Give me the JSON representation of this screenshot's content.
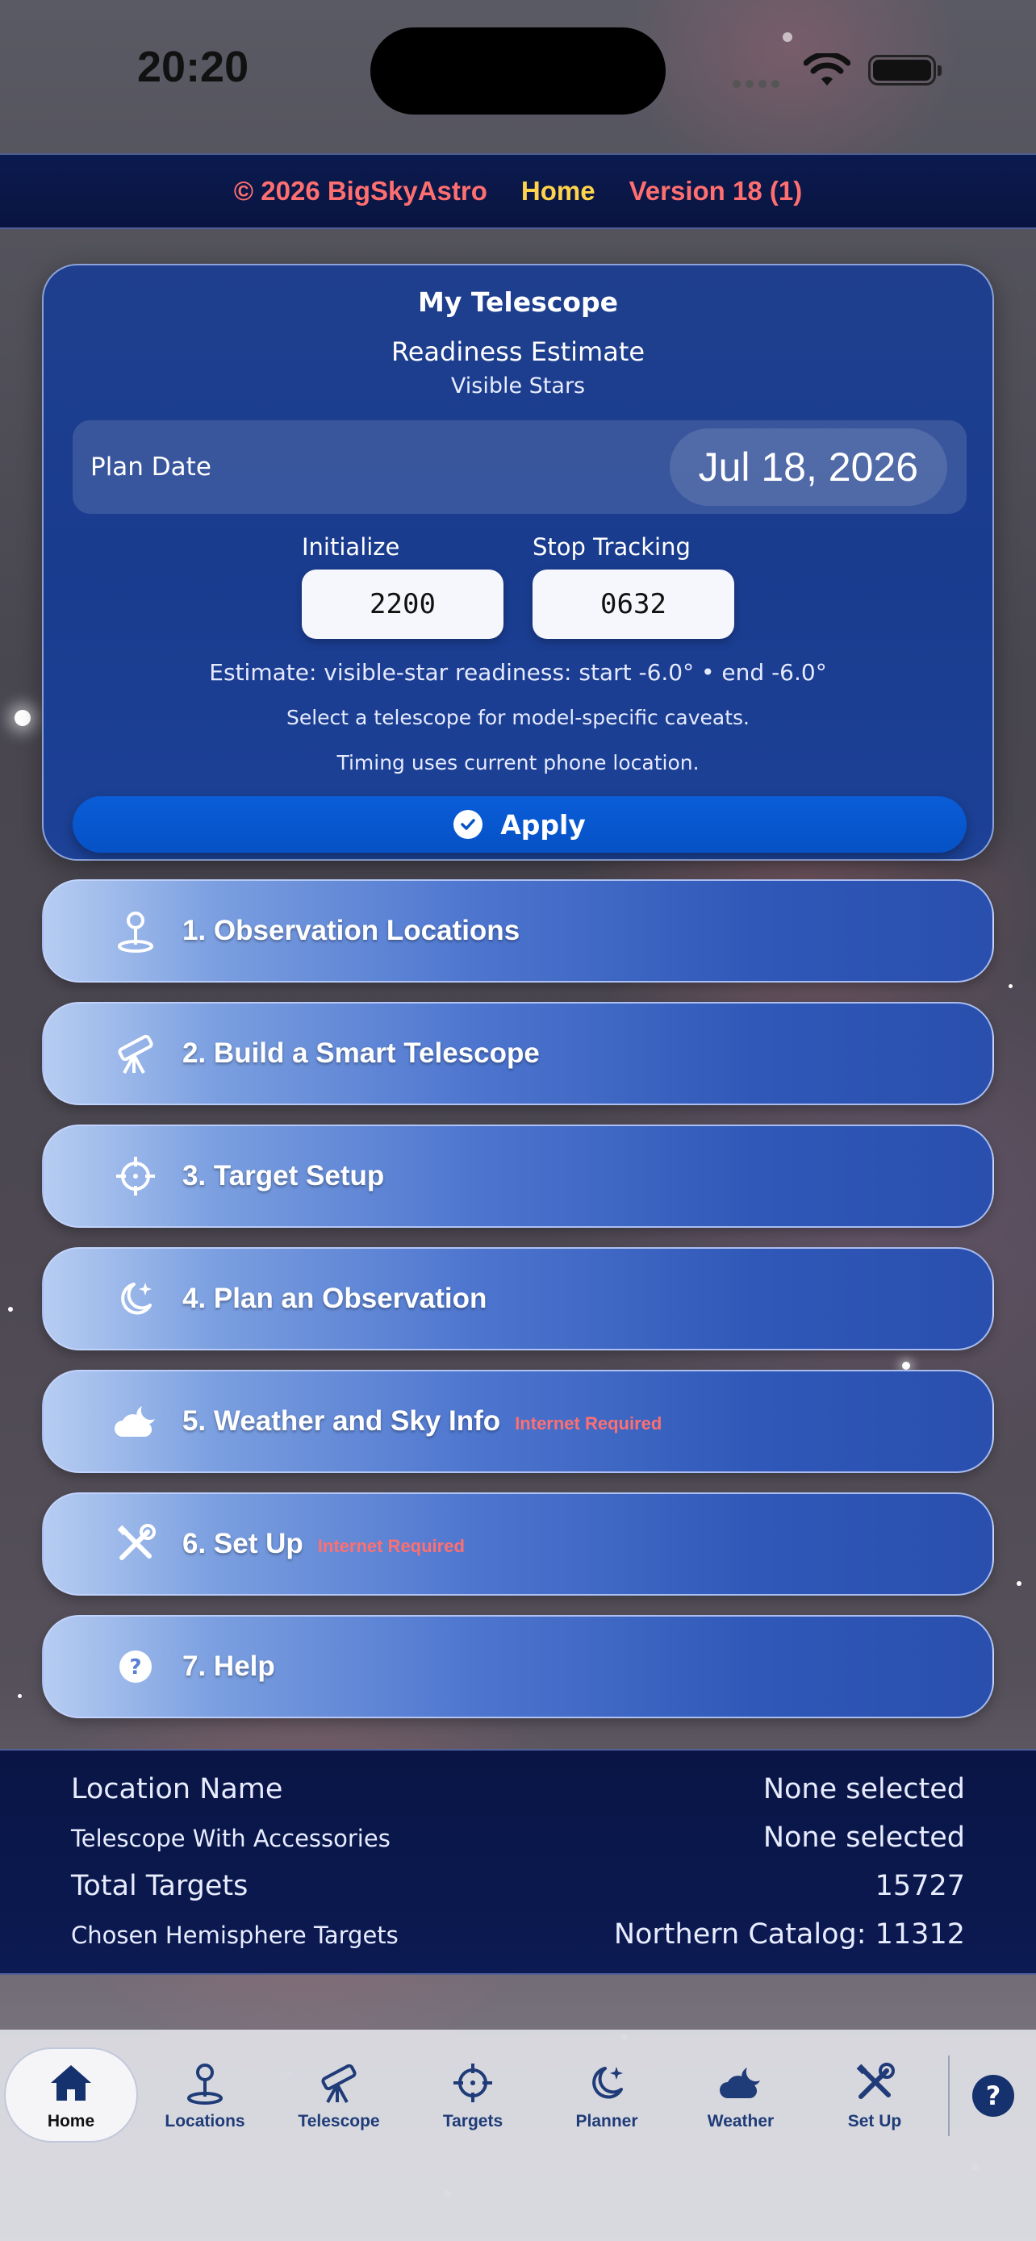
{
  "status_bar": {
    "time": "20:20"
  },
  "header": {
    "copyright": "© 2026 BigSkyAstro",
    "current_page": "Home",
    "version": "Version 18 (1)"
  },
  "telescope_card": {
    "title": "My Telescope",
    "readiness_label": "Readiness Estimate",
    "readiness_sub": "Visible Stars",
    "plan_date_label": "Plan Date",
    "plan_date_value": "Jul 18, 2026",
    "initialize_label": "Initialize",
    "initialize_value": "2200",
    "stop_tracking_label": "Stop Tracking",
    "stop_tracking_value": "0632",
    "estimate_note": "Estimate: visible-star readiness: start -6.0° • end -6.0°",
    "caveat_note": "Select a telescope for model-specific caveats.",
    "location_note": "Timing uses current phone location.",
    "apply_label": "Apply"
  },
  "menu": [
    {
      "label": "1. Observation Locations",
      "icon": "location-pin-icon",
      "badge": ""
    },
    {
      "label": "2. Build a Smart Telescope",
      "icon": "telescope-icon",
      "badge": ""
    },
    {
      "label": "3. Target Setup",
      "icon": "crosshair-icon",
      "badge": ""
    },
    {
      "label": "4. Plan an Observation",
      "icon": "moon-stars-icon",
      "badge": ""
    },
    {
      "label": "5. Weather and Sky Info",
      "icon": "cloud-moon-icon",
      "badge": "Internet Required"
    },
    {
      "label": "6. Set Up",
      "icon": "tools-icon",
      "badge": "Internet Required"
    },
    {
      "label": "7. Help",
      "icon": "question-circle-icon",
      "badge": ""
    }
  ],
  "info": {
    "location_name_label": "Location Name",
    "location_name_value": "None selected",
    "telescope_label": "Telescope With Accessories",
    "telescope_value": "None selected",
    "total_targets_label": "Total Targets",
    "total_targets_value": "15727",
    "hemisphere_label": "Chosen Hemisphere Targets",
    "hemisphere_value": "Northern Catalog: 11312"
  },
  "tabs": [
    {
      "label": "Home",
      "icon": "house-icon",
      "active": true
    },
    {
      "label": "Locations",
      "icon": "location-pin-icon",
      "active": false
    },
    {
      "label": "Telescope",
      "icon": "telescope-icon",
      "active": false
    },
    {
      "label": "Targets",
      "icon": "crosshair-icon",
      "active": false
    },
    {
      "label": "Planner",
      "icon": "moon-stars-icon",
      "active": false
    },
    {
      "label": "Weather",
      "icon": "cloud-moon-icon",
      "active": false
    },
    {
      "label": "Set Up",
      "icon": "tools-icon",
      "active": false
    }
  ],
  "help_button": {
    "label": "?"
  },
  "colors": {
    "header_accent_red": "#ff6f70",
    "header_accent_yellow": "#ffd34a",
    "card_blue": "#1c3f92",
    "apply_blue": "#0a5cd8",
    "tab_icon_blue": "#1f3b78"
  }
}
